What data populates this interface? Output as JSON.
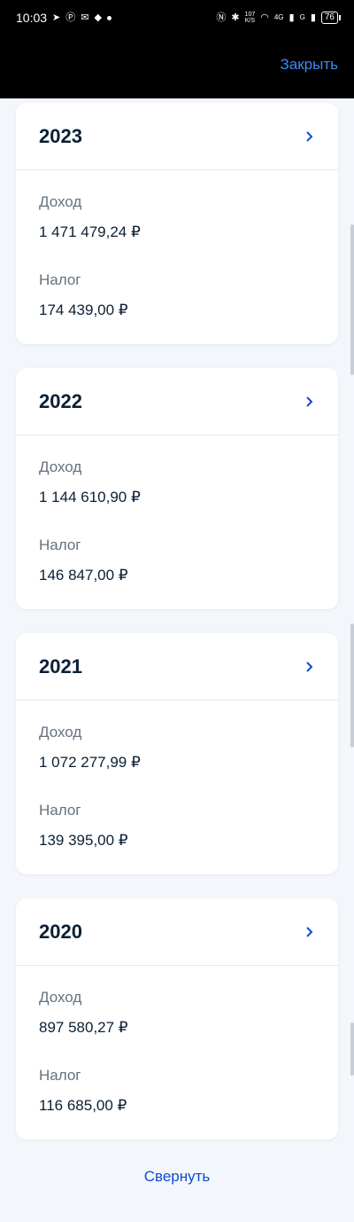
{
  "status_bar": {
    "time": "10:03",
    "left_icons": [
      "telegram-icon",
      "p-icon",
      "mail-icon",
      "app-icon",
      "dot-icon"
    ],
    "net_speed": "107\nK/S",
    "signal1_label": "4G",
    "signal2_label": "G",
    "battery": "76"
  },
  "header": {
    "close_label": "Закрыть"
  },
  "cards": [
    {
      "year": "2023",
      "income_label": "Доход",
      "income": "1 471 479,24 ₽",
      "tax_label": "Налог",
      "tax": "174 439,00 ₽"
    },
    {
      "year": "2022",
      "income_label": "Доход",
      "income": "1 144 610,90 ₽",
      "tax_label": "Налог",
      "tax": "146 847,00 ₽"
    },
    {
      "year": "2021",
      "income_label": "Доход",
      "income": "1 072 277,99 ₽",
      "tax_label": "Налог",
      "tax": "139 395,00 ₽"
    },
    {
      "year": "2020",
      "income_label": "Доход",
      "income": "897 580,27 ₽",
      "tax_label": "Налог",
      "tax": "116 685,00 ₽"
    }
  ],
  "footer": {
    "collapse_label": "Свернуть"
  },
  "colors": {
    "accent": "#0d4cd3",
    "close_link": "#3b8bf5",
    "background": "#f3f6fb"
  }
}
